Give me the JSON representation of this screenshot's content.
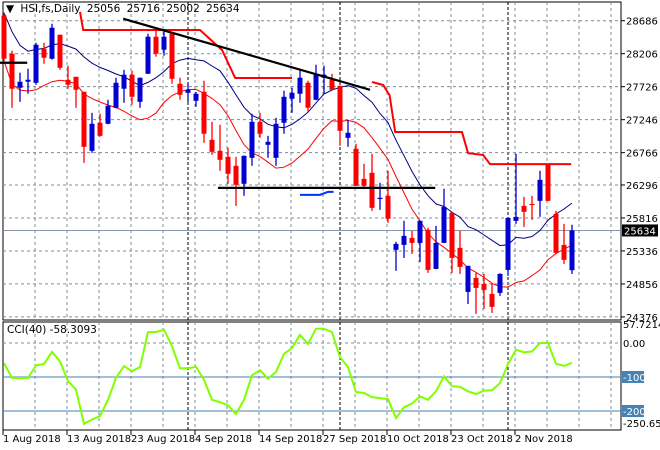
{
  "header": {
    "symbol": "HSI,fs,Daily",
    "open": "25056",
    "high": "25716",
    "low": "25002",
    "close": "25634"
  },
  "colors": {
    "bull": "#0000d0",
    "bear": "#ff0000",
    "ma_high": "#000080",
    "ma_low": "#ff0000",
    "stop_line": "#ff0000",
    "trend": "#000000",
    "cci": "#7fff00",
    "levels": "#4682b4",
    "grid": "#7f8c9a"
  },
  "price_axis": {
    "labels": [
      "28686",
      "28206",
      "27726",
      "27246",
      "26766",
      "26296",
      "25816",
      "25336",
      "24856",
      "24376"
    ],
    "current": "25634"
  },
  "cci": {
    "title": "CCI(40) -58.3093",
    "axis_labels": {
      "max": "57.7214",
      "zero": "0.00",
      "l100": "-100",
      "l200": "-200",
      "min": "-250.650"
    },
    "values": [
      -59,
      -103,
      -103,
      -103,
      -66,
      -62,
      -26,
      -54,
      -112,
      -137,
      -238,
      -225,
      -215,
      -167,
      -103,
      -68,
      -83,
      -71,
      32,
      32,
      39,
      -9,
      -74,
      -74,
      -70,
      -108,
      -167,
      -174,
      -183,
      -209,
      -167,
      -95,
      -80,
      -105,
      -85,
      -32,
      -15,
      24,
      -3,
      42,
      42,
      32,
      -42,
      -71,
      -144,
      -147,
      -159,
      -162,
      -165,
      -221,
      -189,
      -178,
      -157,
      -167,
      -142,
      -98,
      -127,
      -129,
      -142,
      -150,
      -140,
      -139,
      -118,
      -62,
      -20,
      -27,
      -25,
      0,
      0,
      -61,
      -67,
      -58.3
    ]
  },
  "x_axis": {
    "labels": [
      {
        "index": 0,
        "text": "1 Aug 2018"
      },
      {
        "index": 8,
        "text": "13 Aug 2018"
      },
      {
        "index": 16,
        "text": "23 Aug 2018"
      },
      {
        "index": 24,
        "text": "4 Sep 2018"
      },
      {
        "index": 32,
        "text": "14 Sep 2018"
      },
      {
        "index": 40,
        "text": "27 Sep 2018"
      },
      {
        "index": 48,
        "text": "10 Oct 2018"
      },
      {
        "index": 56,
        "text": "23 Oct 2018"
      },
      {
        "index": 64,
        "text": "2 Nov 2018"
      }
    ],
    "separators": [
      23,
      42,
      63
    ]
  },
  "chart_data": {
    "type": "candlestick",
    "title": "HSI,fs,Daily",
    "ylim": [
      24376,
      28686
    ],
    "ma_period": 10,
    "candles_ohlc": [
      [
        28759,
        28802,
        28103,
        28133
      ],
      [
        28205,
        28249,
        27419,
        27696
      ],
      [
        27710,
        27929,
        27506,
        27798
      ],
      [
        27798,
        27987,
        27623,
        27827
      ],
      [
        27783,
        28365,
        27754,
        28336
      ],
      [
        28278,
        28365,
        28060,
        28147
      ],
      [
        28133,
        28642,
        28120,
        28584
      ],
      [
        28482,
        28482,
        27972,
        28001
      ],
      [
        27827,
        28031,
        27696,
        27754
      ],
      [
        27870,
        27870,
        27419,
        27681
      ],
      [
        27652,
        27652,
        26618,
        26851
      ],
      [
        26793,
        27346,
        26764,
        27186
      ],
      [
        27201,
        27332,
        27000,
        27011
      ],
      [
        27186,
        27536,
        27180,
        27448
      ],
      [
        27419,
        27856,
        27410,
        27783
      ],
      [
        27696,
        27972,
        27492,
        27900
      ],
      [
        27900,
        27958,
        27463,
        27579
      ],
      [
        27506,
        27860,
        27419,
        27856
      ],
      [
        27914,
        28497,
        27910,
        28453
      ],
      [
        28453,
        28555,
        28162,
        28205
      ],
      [
        28264,
        28540,
        28176,
        28453
      ],
      [
        28497,
        28497,
        27769,
        27841
      ],
      [
        27769,
        27856,
        27536,
        27608
      ],
      [
        27637,
        27783,
        27506,
        27681
      ],
      [
        27521,
        27650,
        27434,
        27623
      ],
      [
        27652,
        27812,
        26909,
        27041
      ],
      [
        26953,
        27215,
        26735,
        26778
      ],
      [
        26793,
        27172,
        26502,
        26662
      ],
      [
        26706,
        26837,
        26313,
        26458
      ],
      [
        26575,
        26706,
        25992,
        26298
      ],
      [
        26313,
        26725,
        26138,
        26720
      ],
      [
        26691,
        27332,
        26575,
        27215
      ],
      [
        27215,
        27346,
        26982,
        27041
      ],
      [
        26880,
        27011,
        26691,
        26924
      ],
      [
        26691,
        27273,
        26575,
        27186
      ],
      [
        27201,
        27667,
        27041,
        27579
      ],
      [
        27550,
        27710,
        27346,
        27637
      ],
      [
        27623,
        27972,
        27492,
        27856
      ],
      [
        27783,
        27812,
        27361,
        27419
      ],
      [
        27536,
        28045,
        27530,
        27900
      ],
      [
        27856,
        28031,
        27623,
        27900
      ],
      [
        27827,
        27914,
        27675,
        27681
      ],
      [
        27739,
        27739,
        26866,
        27084
      ],
      [
        26982,
        27244,
        26851,
        27055
      ],
      [
        26822,
        26895,
        26280,
        26283
      ],
      [
        26385,
        26604,
        26254,
        26283
      ],
      [
        26473,
        26749,
        25919,
        25963
      ],
      [
        26094,
        26327,
        25934,
        26109
      ],
      [
        26138,
        26502,
        25745,
        25803
      ],
      [
        25352,
        25470,
        25046,
        25439
      ],
      [
        25424,
        25774,
        25235,
        25555
      ],
      [
        25526,
        25628,
        25293,
        25453
      ],
      [
        25453,
        25780,
        25177,
        25774
      ],
      [
        25643,
        25672,
        25017,
        25060
      ],
      [
        25075,
        25701,
        25070,
        25453
      ],
      [
        25453,
        26240,
        25450,
        25978
      ],
      [
        25890,
        25890,
        25017,
        25235
      ],
      [
        25381,
        25628,
        25002,
        25104
      ],
      [
        24740,
        25119,
        24565,
        25119
      ],
      [
        24944,
        25017,
        24420,
        24798
      ],
      [
        24857,
        25002,
        24493,
        24769
      ],
      [
        24711,
        24857,
        24434,
        24522
      ],
      [
        24726,
        25010,
        24682,
        25002
      ],
      [
        25060,
        25820,
        24973,
        25817
      ],
      [
        25774,
        26749,
        25730,
        25832
      ],
      [
        25992,
        26123,
        25686,
        25905
      ],
      [
        26021,
        26138,
        25788,
        26007
      ],
      [
        26065,
        26502,
        25832,
        26371
      ],
      [
        26604,
        26610,
        26060,
        26065
      ],
      [
        25876,
        25919,
        25293,
        25308
      ],
      [
        25424,
        25730,
        25148,
        25206
      ],
      [
        25056,
        25716,
        25002,
        25634
      ]
    ],
    "stop_line": [
      [
        [
          9.5,
          28813
        ],
        [
          9.9,
          28551
        ],
        [
          24.5,
          28551
        ],
        [
          27.25,
          28260
        ],
        [
          28.9,
          27852
        ],
        [
          36,
          27852
        ]
      ],
      [
        [
          46,
          27794
        ],
        [
          47.4,
          27750
        ],
        [
          48.2,
          27600
        ],
        [
          48.9,
          27066
        ],
        [
          57.25,
          27066
        ],
        [
          58,
          26760
        ],
        [
          59.9,
          26731
        ],
        [
          60.75,
          26600
        ],
        [
          70.9,
          26600
        ]
      ]
    ],
    "trendlines": [
      {
        "name": "descending-resistance",
        "points": [
          [
            14.9,
            28715
          ],
          [
            45.75,
            27681
          ]
        ]
      },
      {
        "name": "horizontal-support",
        "points": [
          [
            26.75,
            26254
          ],
          [
            53.9,
            26254
          ]
        ]
      },
      {
        "name": "left-level",
        "points": [
          [
            -0.5,
            28074
          ],
          [
            2.9,
            28074
          ]
        ]
      }
    ],
    "blue_segment": [
      [
        37,
        26152
      ],
      [
        39.5,
        26152
      ],
      [
        40.5,
        26196
      ],
      [
        41.2,
        26196
      ]
    ]
  }
}
